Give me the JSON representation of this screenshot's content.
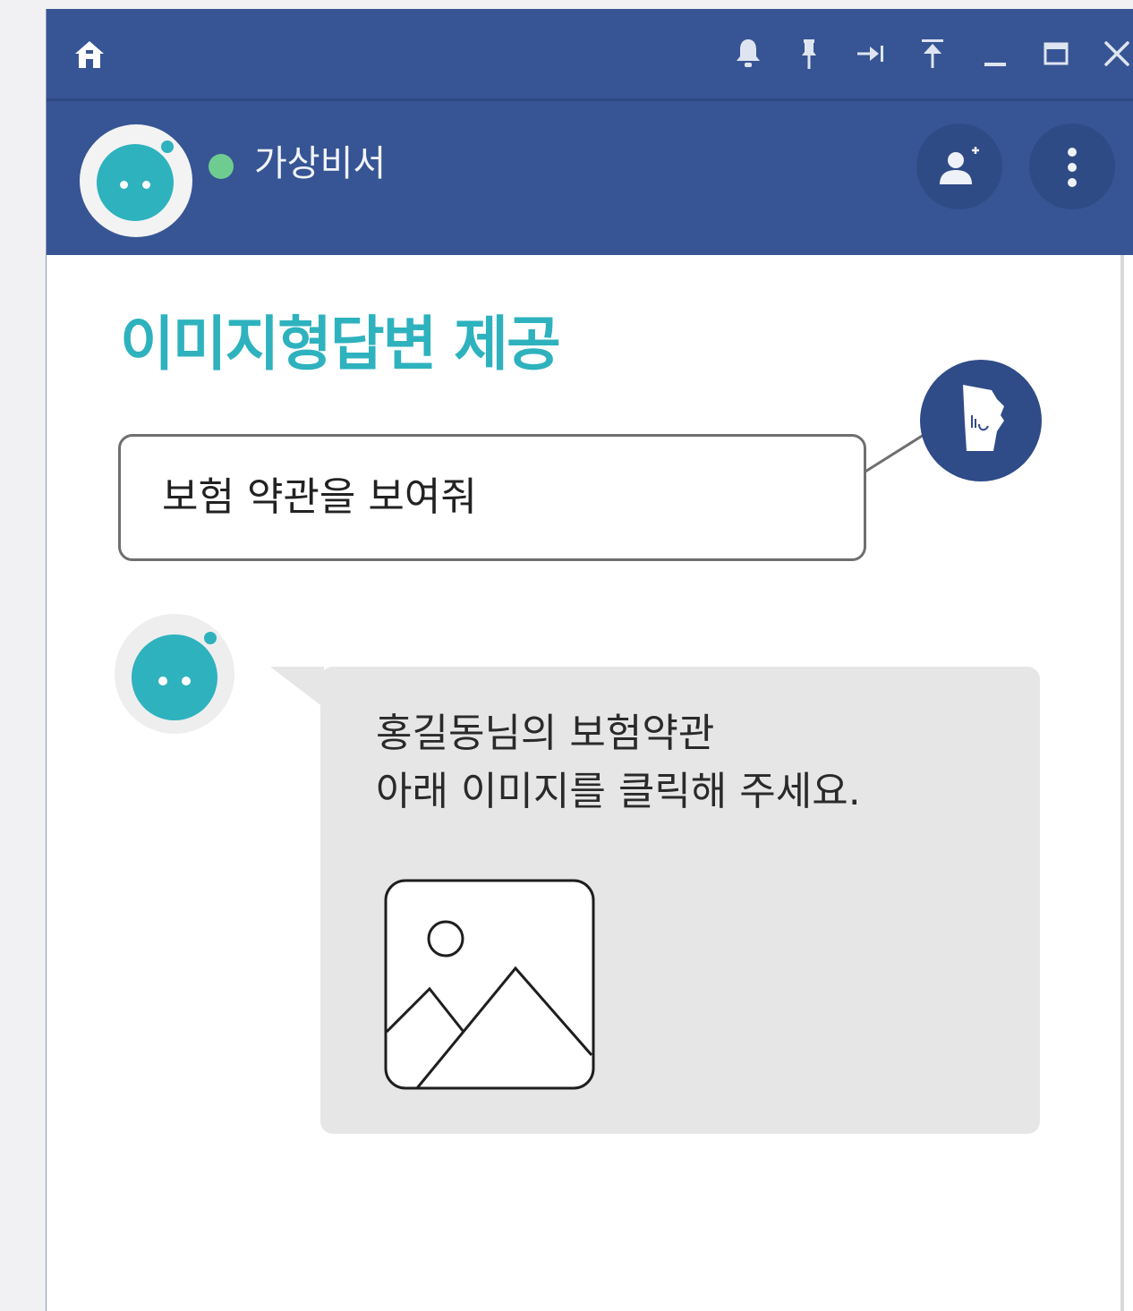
{
  "header": {
    "contact_name": "가상비서",
    "status_color": "#6fcc91",
    "brand_color": "#375594"
  },
  "titlebar_icons": [
    "home-icon",
    "bell-icon",
    "pin-icon",
    "dock-icon",
    "move-top-icon",
    "minimize-icon",
    "maximize-icon",
    "close-icon"
  ],
  "chat": {
    "title": "이미지형답변 제공",
    "user_message": "보험 약관을 보여줘",
    "bot_message": {
      "line1": "홍길동님의 보험약관",
      "line2": "아래 이미지를 클릭해 주세요."
    },
    "accent_color": "#2eb2be"
  }
}
